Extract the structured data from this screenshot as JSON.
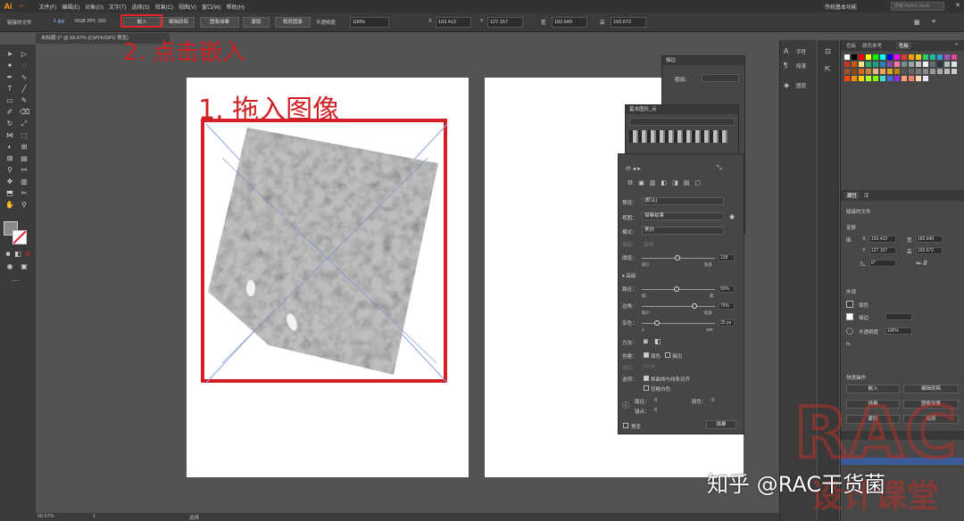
{
  "menubar": {
    "logo": "Ai",
    "items": [
      "文件(F)",
      "编辑(E)",
      "对象(O)",
      "文字(T)",
      "选择(S)",
      "效果(C)",
      "视图(V)",
      "窗口(W)",
      "帮助(H)"
    ],
    "workspace": "传统基本功能",
    "search_placeholder": "搜索 Adobe Stock"
  },
  "control_bar": {
    "object_label": "链接的文件",
    "filename": "1.jpg",
    "color_mode": "RGB PPI: 150",
    "embed_button": "嵌入",
    "edit_original": "编辑原稿",
    "image_trace": "图像描摹",
    "mask": "蒙版",
    "crop_image": "裁剪图像",
    "opacity_label": "不透明度",
    "opacity_value": "100%",
    "x_label": "X",
    "x_value": "103.413",
    "y_label": "Y",
    "y_value": "127.157",
    "w_label": "宽",
    "w_value": "182.649",
    "h_label": "高",
    "h_value": "193.672"
  },
  "document_tab": "未标题-1* @ 66.67% (CMYK/GPU 预览)",
  "annotations": {
    "step1": "1. 拖入图像",
    "step2": "2. 点击嵌入"
  },
  "trace_panel": {
    "header": "图像描摹",
    "preset_label": "预设：",
    "preset_value": "[默认]",
    "view_label": "视图：",
    "view_value": "描摹结果",
    "mode_label": "模式：",
    "mode_value": "黑白",
    "palette_label": "调板：",
    "palette_value": "有限",
    "threshold_label": "阈值：",
    "threshold_value": "128",
    "threshold_min": "较少",
    "threshold_max": "较多",
    "advanced": "高级",
    "paths_label": "路径：",
    "paths_value": "50%",
    "paths_min": "低",
    "paths_max": "高",
    "corners_label": "边角：",
    "corners_value": "75%",
    "corners_min": "较少",
    "corners_max": "较多",
    "noise_label": "杂色：",
    "noise_value": "25 px",
    "noise_min": "1",
    "noise_max": "100",
    "method_label": "方法：",
    "create_label": "创建：",
    "fills": "填色",
    "strokes": "描边",
    "stroke_label": "描边：",
    "stroke_value": "10 px",
    "options_label": "选项：",
    "snap_curves": "将曲线与线条对齐",
    "ignore_white": "忽略白色",
    "paths_count_label": "路径：",
    "paths_count": "0",
    "colors_count_label": "颜色：",
    "colors_count": "0",
    "anchors_label": "锚点：",
    "anchors_count": "0",
    "preview_label": "预览",
    "trace_button": "描摹"
  },
  "brush_panel": {
    "header": "基本图形_点"
  },
  "stroke_panel": {
    "header": "描边",
    "weight_label": "粗细："
  },
  "narrow_dock": {
    "items": [
      "字符",
      "段落",
      "图层"
    ]
  },
  "right_panel": {
    "tabs": [
      "色板",
      "颜色参考",
      "色板"
    ],
    "props_tabs": [
      "属性",
      "库"
    ],
    "linked_file": "链接的文件",
    "transform": "变换",
    "x": "103.413",
    "y": "127.157",
    "w": "182.649",
    "h": "193.672",
    "rotate": "0°",
    "appearance": "外观",
    "fill": "填色",
    "stroke": "描边",
    "opacity_label": "不透明度",
    "opacity": "100%",
    "fx": "fx.",
    "quick_actions": "快速操作",
    "embed": "嵌入",
    "edit_original": "编辑原稿",
    "trace": "描摹",
    "image_trace": "图像描摹",
    "mask": "蒙版",
    "crop": "裁剪"
  },
  "status_bar": {
    "zoom": "66.67%",
    "page": "1",
    "tool": "选择"
  },
  "watermarks": {
    "zhihu": "知乎 @RAC干货菌",
    "rac": "RAC",
    "rac_sub": "设计课堂"
  },
  "colors": {
    "annotation_red": "#d41f26",
    "menu_bg": "#323232",
    "panel_bg": "#464646",
    "canvas_bg": "#535353"
  }
}
